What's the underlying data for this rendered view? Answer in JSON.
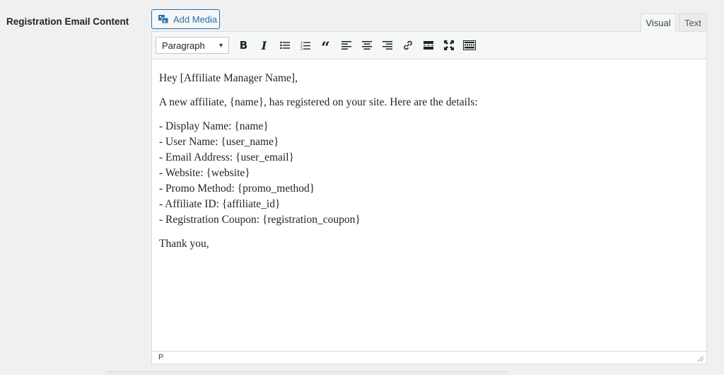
{
  "field": {
    "label": "Registration Email Content"
  },
  "media": {
    "add_media_label": "Add Media"
  },
  "tabs": {
    "visual": "Visual",
    "text": "Text",
    "active": "Visual"
  },
  "toolbar": {
    "format_select": "Paragraph",
    "buttons": [
      "bold-icon",
      "italic-icon",
      "bulleted-list-icon",
      "numbered-list-icon",
      "blockquote-icon",
      "align-left-icon",
      "align-center-icon",
      "align-right-icon",
      "link-icon",
      "read-more-icon",
      "fullscreen-icon",
      "toolbar-toggle-icon"
    ]
  },
  "content": {
    "greeting": "Hey [Affiliate Manager Name],",
    "intro": "A new affiliate, {name}, has registered on your site. Here are the details:",
    "details": [
      "- Display Name: {name}",
      "- User Name: {user_name}",
      "- Email Address: {user_email}",
      "- Website: {website}",
      "- Promo Method: {promo_method}",
      "- Affiliate ID: {affiliate_id}",
      "- Registration Coupon: {registration_coupon}"
    ],
    "closing": "Thank you,"
  },
  "statusbar": {
    "path": "P"
  },
  "colors": {
    "accent": "#2271b1",
    "background": "#f0f0f1",
    "border": "#dcdcde"
  }
}
